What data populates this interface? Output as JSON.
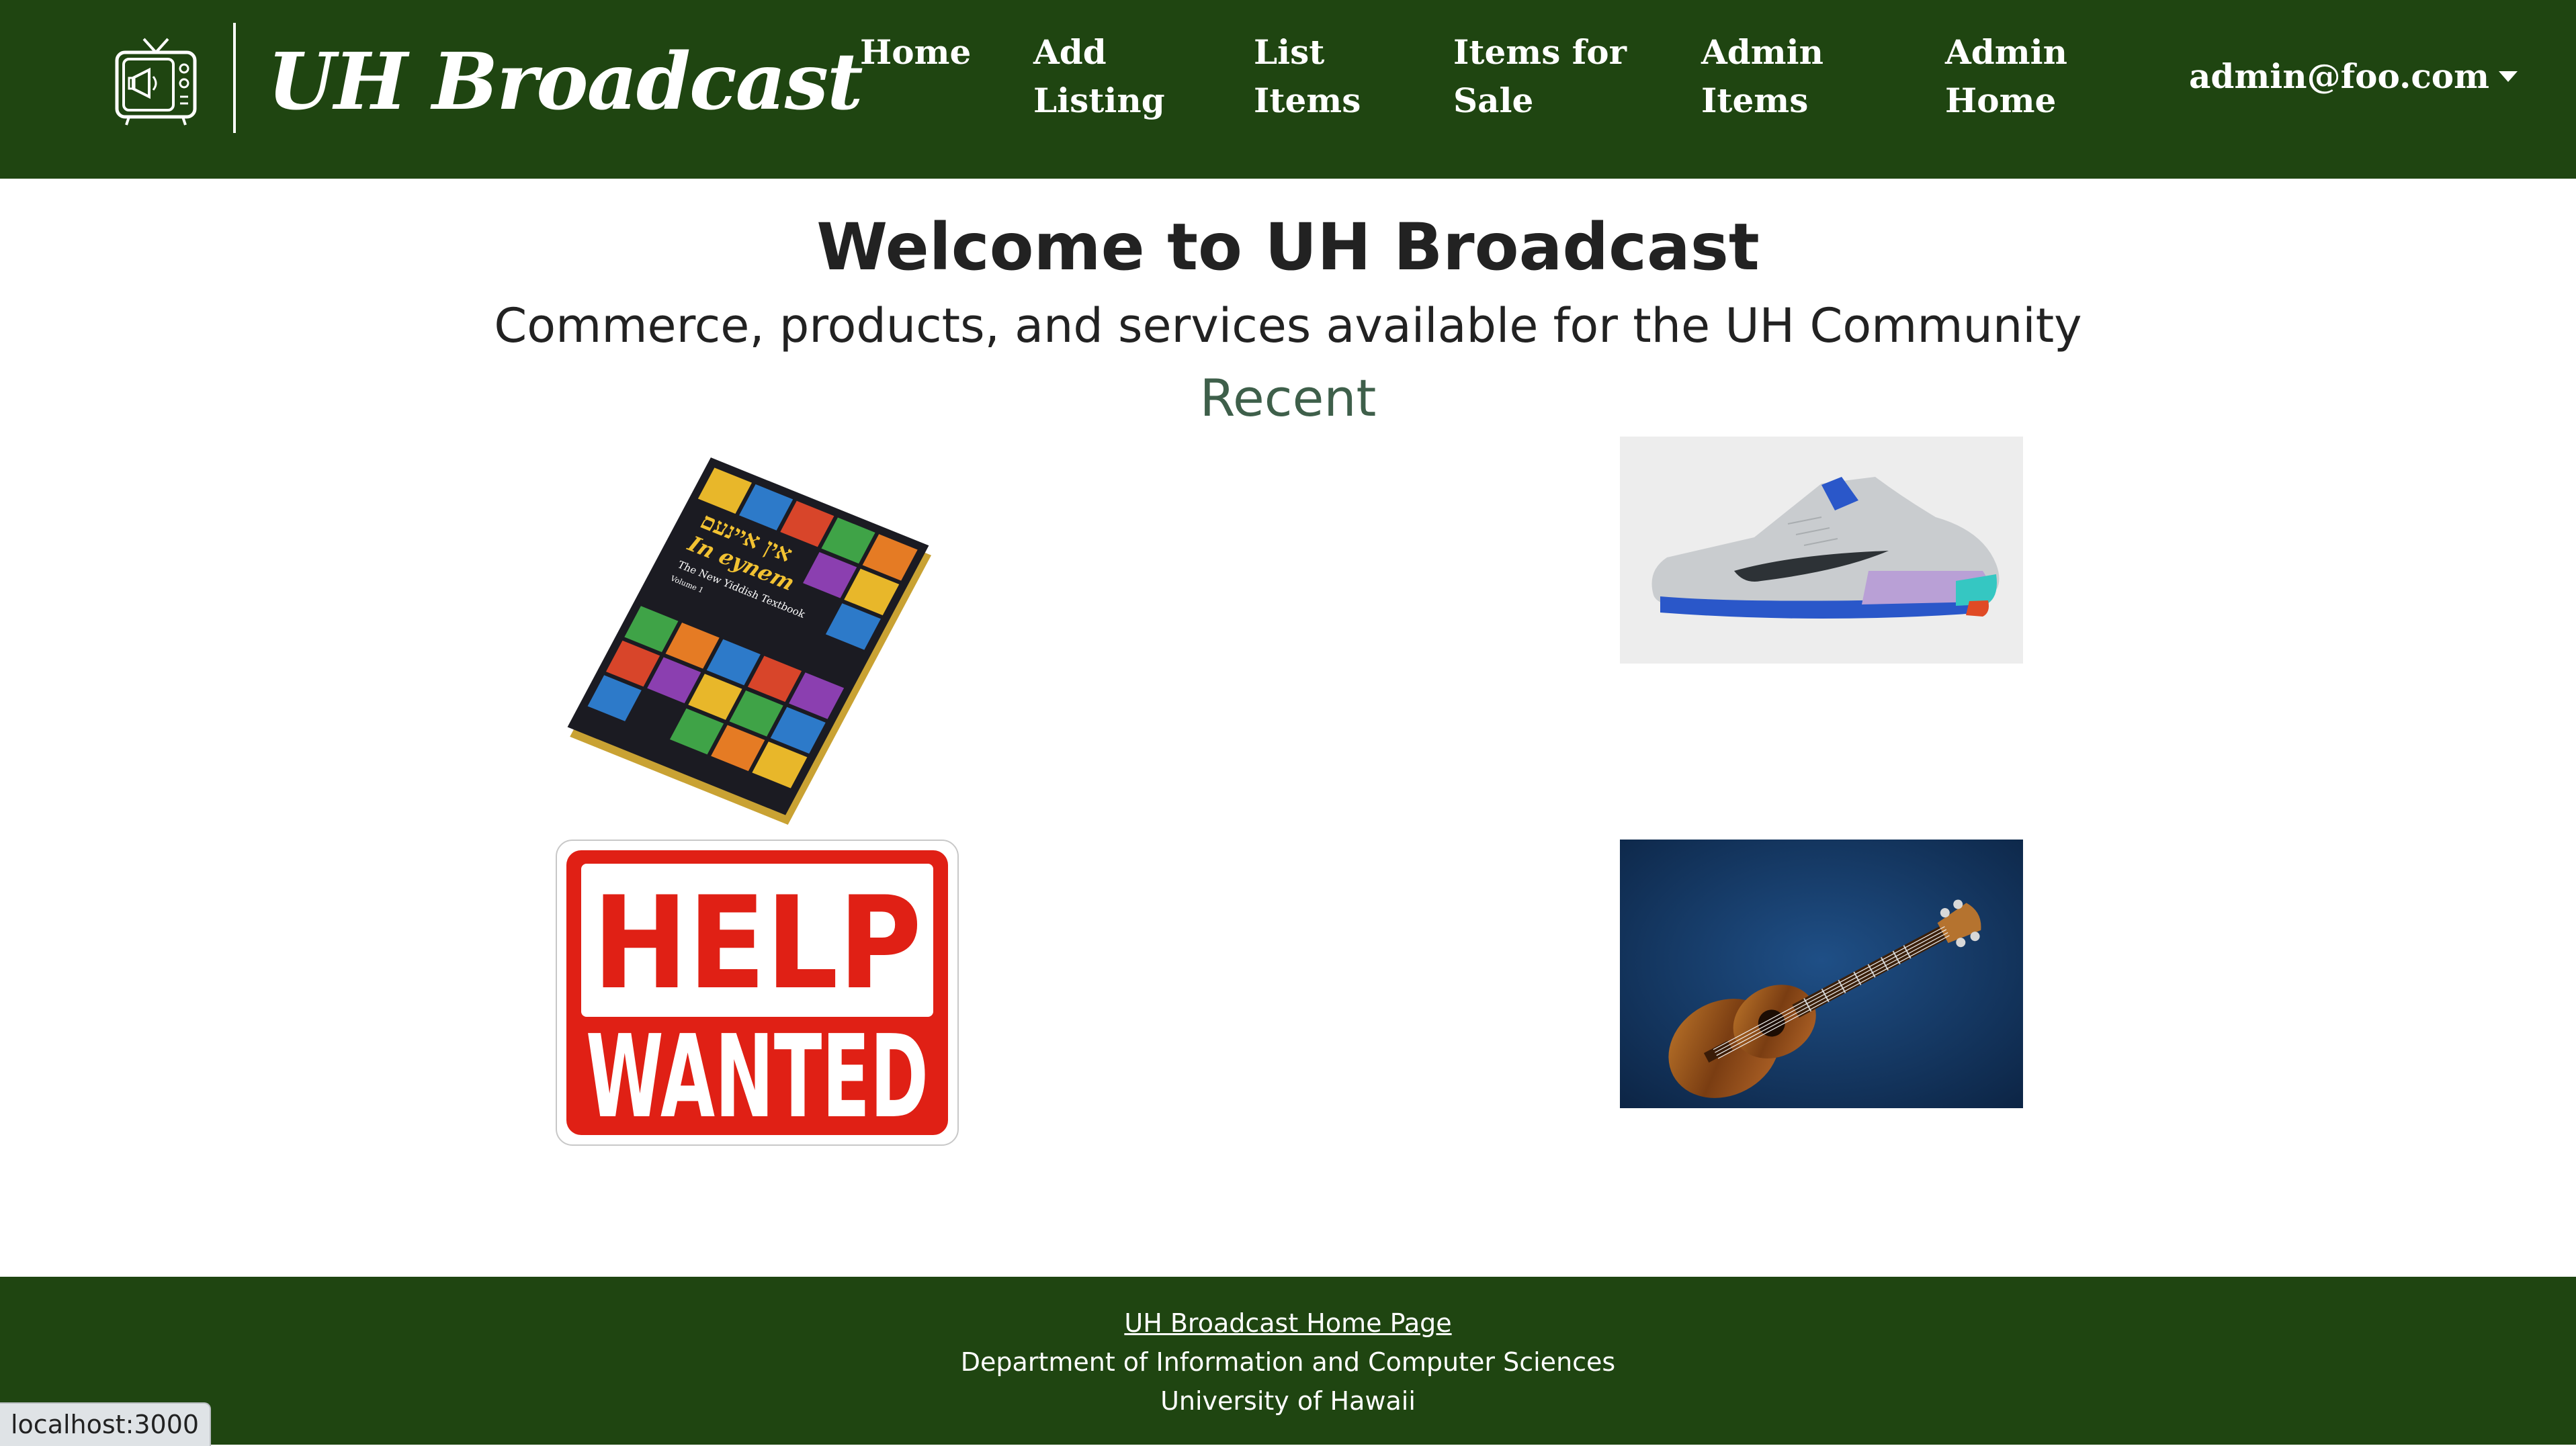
{
  "navbar": {
    "brand": "UH Broadcast",
    "logo_icon": "tv-megaphone-icon",
    "links": {
      "home": "Home",
      "add_listing": "Add Listing",
      "list_items": "List Items",
      "items_for_sale": "Items for Sale",
      "admin_items": "Admin Items",
      "admin_home": "Admin Home"
    },
    "user": "admin@foo.com",
    "user_caret_icon": "caret-down-icon"
  },
  "main": {
    "title": "Welcome to UH Broadcast",
    "subtitle": "Commerce, products, and services available for the UH Community",
    "section": "Recent",
    "items": [
      {
        "image": "book-cover-image",
        "cover_title_hebrew": "אין איינעם",
        "cover_title": "In eynem",
        "cover_subtitle": "The New Yiddish Textbook",
        "cover_volume": "Volume 1"
      },
      {
        "image": "sneaker-image"
      },
      {
        "image": "help-wanted-sign-image",
        "sign_line1": "HELP",
        "sign_line2": "WANTED"
      },
      {
        "image": "ukulele-image"
      }
    ]
  },
  "footer": {
    "link": "UH Broadcast Home Page",
    "department": "Department of Information and Computer Sciences",
    "university": "University of Hawaii"
  },
  "status_bar": {
    "url": "localhost:3000"
  },
  "colors": {
    "navbar_bg": "#1f4511",
    "footer_bg": "#1f4511",
    "recent_heading": "#3e5f4a",
    "help_red": "#e02015"
  }
}
